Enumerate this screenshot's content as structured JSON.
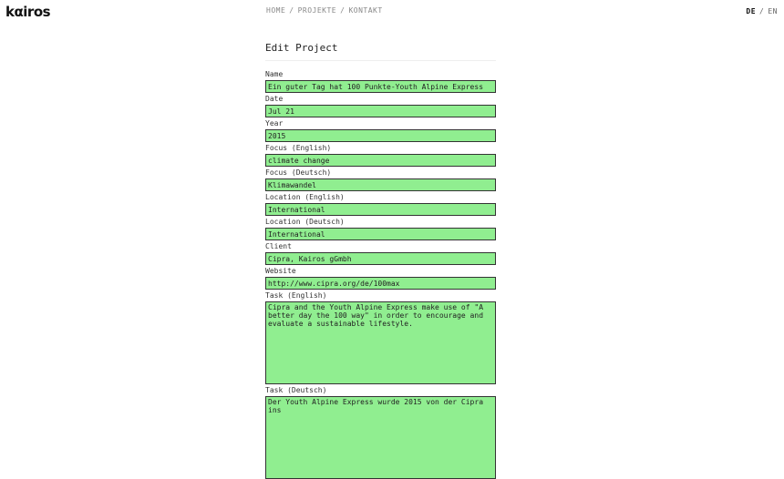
{
  "brand": {
    "logo_text": "kαiros"
  },
  "nav": {
    "items": [
      "HOME",
      "PROJEKTE",
      "KONTAKT"
    ],
    "separator": "/"
  },
  "lang": {
    "active": "DE",
    "separator": "/",
    "other": "EN"
  },
  "form": {
    "title": "Edit Project",
    "fields": {
      "name": {
        "label": "Name",
        "value": "Ein guter Tag hat 100 Punkte-Youth Alpine Express"
      },
      "date": {
        "label": "Date",
        "value": "Jul 21"
      },
      "year": {
        "label": "Year",
        "value": "2015"
      },
      "focus_en": {
        "label": "Focus (English)",
        "value": "climate change"
      },
      "focus_de": {
        "label": "Focus (Deutsch)",
        "value": "Klimawandel"
      },
      "location_en": {
        "label": "Location (English)",
        "value": "International"
      },
      "location_de": {
        "label": "Location (Deutsch)",
        "value": "International"
      },
      "client": {
        "label": "Client",
        "value": "Cipra, Kairos gGmbh"
      },
      "website": {
        "label": "Website",
        "value": "http://www.cipra.org/de/100max"
      },
      "task_en": {
        "label": "Task (English)",
        "value": "Cipra and the Youth Alpine Express make use of \"A better day the 100 way\" in order to encourage and evaluate a sustainable lifestyle."
      },
      "task_de": {
        "label": "Task (Deutsch)",
        "value": "Der Youth Alpine Express wurde 2015 von der Cipra ins"
      }
    }
  },
  "colors": {
    "field_bg": "#90ee90",
    "field_border": "#333333"
  }
}
